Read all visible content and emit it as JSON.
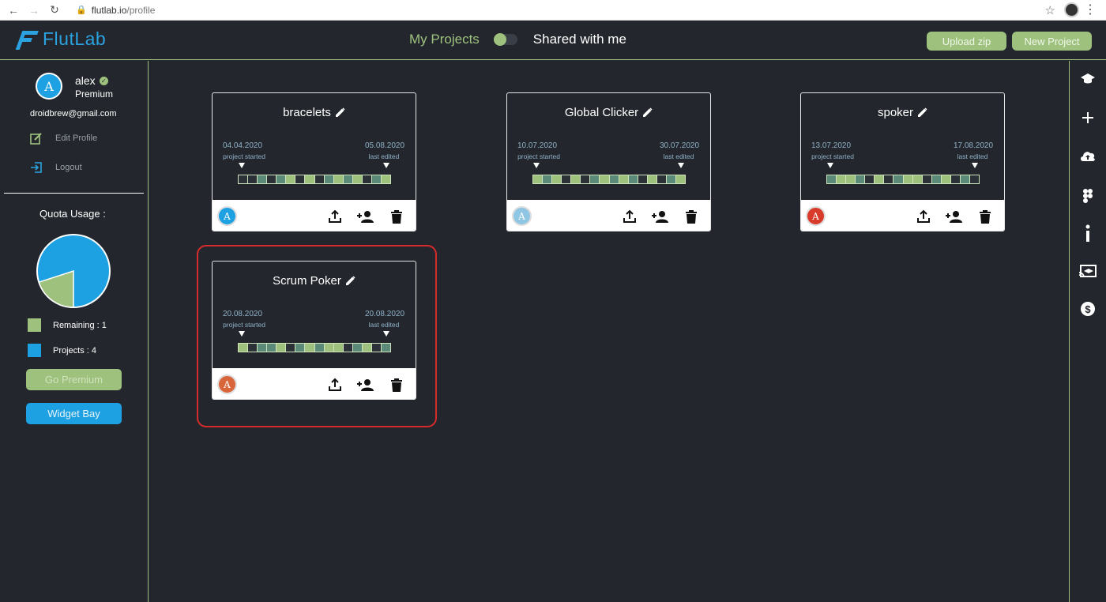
{
  "browser": {
    "url_host": "flutlab.io",
    "url_path": "/profile"
  },
  "header": {
    "logo_text": "FlutLab",
    "tab_my_projects": "My Projects",
    "tab_shared": "Shared with me",
    "upload_label": "Upload zip",
    "new_project_label": "New Project",
    "accent_color": "#9ec27e",
    "brand_color": "#2ba3e0"
  },
  "sidebar": {
    "avatar_letter": "A",
    "username": "alex",
    "plan": "Premium",
    "email": "droidbrew@gmail.com",
    "edit_profile": "Edit Profile",
    "logout": "Logout",
    "quota_title": "Quota Usage :",
    "legend_remaining": "Remaining : 1",
    "legend_projects": "Projects : 4",
    "remaining_count": 1,
    "projects_count": 4,
    "go_premium": "Go Premium",
    "widget_bay": "Widget Bay"
  },
  "right_sidebar": {
    "icons": [
      "graduation-cap-icon",
      "plus-icon",
      "cloud-upload-icon",
      "figma-icon",
      "info-icon",
      "cast-icon",
      "dollar-icon"
    ]
  },
  "projects": [
    {
      "name": "bracelets",
      "started": "04.04.2020",
      "started_label": "project started",
      "edited": "05.08.2020",
      "edited_label": "last edited",
      "avatar_letter": "A",
      "avatar_color": "#1da1e2",
      "cells": [
        "d",
        "d",
        "m",
        "d",
        "m",
        "l",
        "d",
        "l",
        "d",
        "m",
        "l",
        "m",
        "l",
        "d",
        "m",
        "l"
      ]
    },
    {
      "name": "Global Clicker",
      "started": "10.07.2020",
      "started_label": "project started",
      "edited": "30.07.2020",
      "edited_label": "last edited",
      "avatar_letter": "A",
      "avatar_color": "#8fc6e4",
      "cells": [
        "l",
        "m",
        "l",
        "d",
        "l",
        "d",
        "m",
        "l",
        "m",
        "l",
        "m",
        "d",
        "l",
        "d",
        "m",
        "l"
      ]
    },
    {
      "name": "spoker",
      "started": "13.07.2020",
      "started_label": "project started",
      "edited": "17.08.2020",
      "edited_label": "last edited",
      "avatar_letter": "A",
      "avatar_color": "#d93b2b",
      "cells": [
        "m",
        "l",
        "l",
        "m",
        "d",
        "l",
        "d",
        "m",
        "l",
        "l",
        "d",
        "m",
        "l",
        "d",
        "m",
        "d"
      ]
    },
    {
      "name": "Scrum Poker",
      "started": "20.08.2020",
      "started_label": "project started",
      "edited": "20.08.2020",
      "edited_label": "last edited",
      "avatar_letter": "A",
      "avatar_color": "#d9663a",
      "cells": [
        "l",
        "d",
        "m",
        "m",
        "l",
        "d",
        "m",
        "l",
        "m",
        "l",
        "l",
        "d",
        "m",
        "l",
        "d",
        "m"
      ]
    }
  ]
}
